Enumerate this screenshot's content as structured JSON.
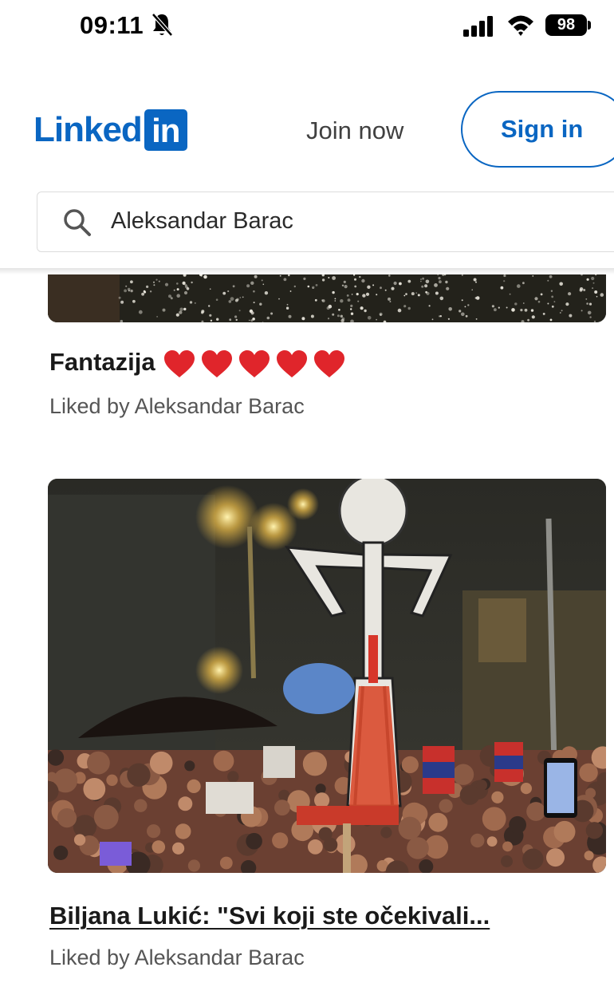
{
  "status_bar": {
    "time": "09:11",
    "battery": "98"
  },
  "header": {
    "logo_text": "Linked",
    "logo_box": "in",
    "join_label": "Join now",
    "signin_label": "Sign in"
  },
  "search": {
    "value": "Aleksandar Barac"
  },
  "feed": [
    {
      "title": "Fantazija",
      "hearts": 5,
      "subtitle": "Liked by Aleksandar Barac"
    },
    {
      "title": "Biljana Lukić: \"Svi koji ste očekivali...",
      "subtitle": "Liked by Aleksandar Barac"
    }
  ],
  "colors": {
    "brand": "#0a66c2",
    "heart": "#e0252b"
  }
}
